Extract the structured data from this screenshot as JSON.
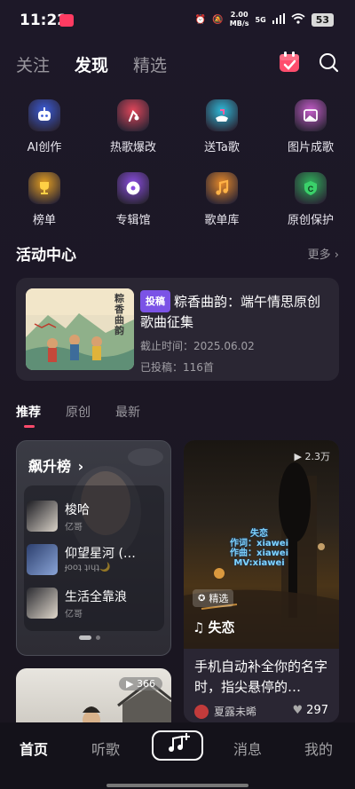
{
  "status_bar": {
    "time": "11:22",
    "net_speed_value": "2.00",
    "net_speed_unit": "MB/s",
    "network": "5G",
    "battery": "53"
  },
  "top_nav": {
    "tabs": [
      "关注",
      "发现",
      "精选"
    ],
    "active_tab": "发现"
  },
  "features": [
    {
      "label": "AI创作",
      "icon": "robot-icon",
      "color": "#3b5bd6"
    },
    {
      "label": "热歌爆改",
      "icon": "hot-song-icon",
      "color": "#e0465a"
    },
    {
      "label": "送Ta歌",
      "icon": "gift-song-icon",
      "color": "#2fb9d8"
    },
    {
      "label": "图片成歌",
      "icon": "image-song-icon",
      "color": "#c45cc9"
    },
    {
      "label": "榜单",
      "icon": "trophy-icon",
      "color": "#e6a021"
    },
    {
      "label": "专辑馆",
      "icon": "album-icon",
      "color": "#8a4de0"
    },
    {
      "label": "歌单库",
      "icon": "music-note-icon",
      "color": "#e6892a"
    },
    {
      "label": "原创保护",
      "icon": "copyright-shield-icon",
      "color": "#2fb05a"
    }
  ],
  "activity_section": {
    "title": "活动中心",
    "more": "更多 ›"
  },
  "activity": {
    "badge": "投稿",
    "title": "粽香曲韵：端午情思原创歌曲征集",
    "deadline": "截止时间：2025.06.02",
    "submissions": "已投稿：116首",
    "cover_text": "粽香曲韵"
  },
  "sub_tabs": [
    "推荐",
    "原创",
    "最新"
  ],
  "rank_card": {
    "title": "飙升榜",
    "items": [
      {
        "song": "梭哈",
        "artist": "亿哥"
      },
      {
        "song": "仰望星河 (…",
        "artist": "ɟooʇ ʇıɥʇ🌙"
      },
      {
        "song": "生活全靠浪",
        "artist": "亿哥"
      }
    ]
  },
  "video_card": {
    "play_count": "▶ 2.3万",
    "lyric_lines": [
      "失恋",
      "作词：xiawei",
      "作曲：xiawei",
      "MV:xiawei"
    ],
    "featured_tag": "精选",
    "song": "失恋",
    "description": "手机自动补全你的名字时，指尖悬停的…",
    "author": "夏露未晞",
    "likes": "297"
  },
  "poster_card": {
    "play_count": "▶ 366"
  },
  "bottom_nav": {
    "home": "首页",
    "listen": "听歌",
    "messages": "消息",
    "mine": "我的"
  }
}
